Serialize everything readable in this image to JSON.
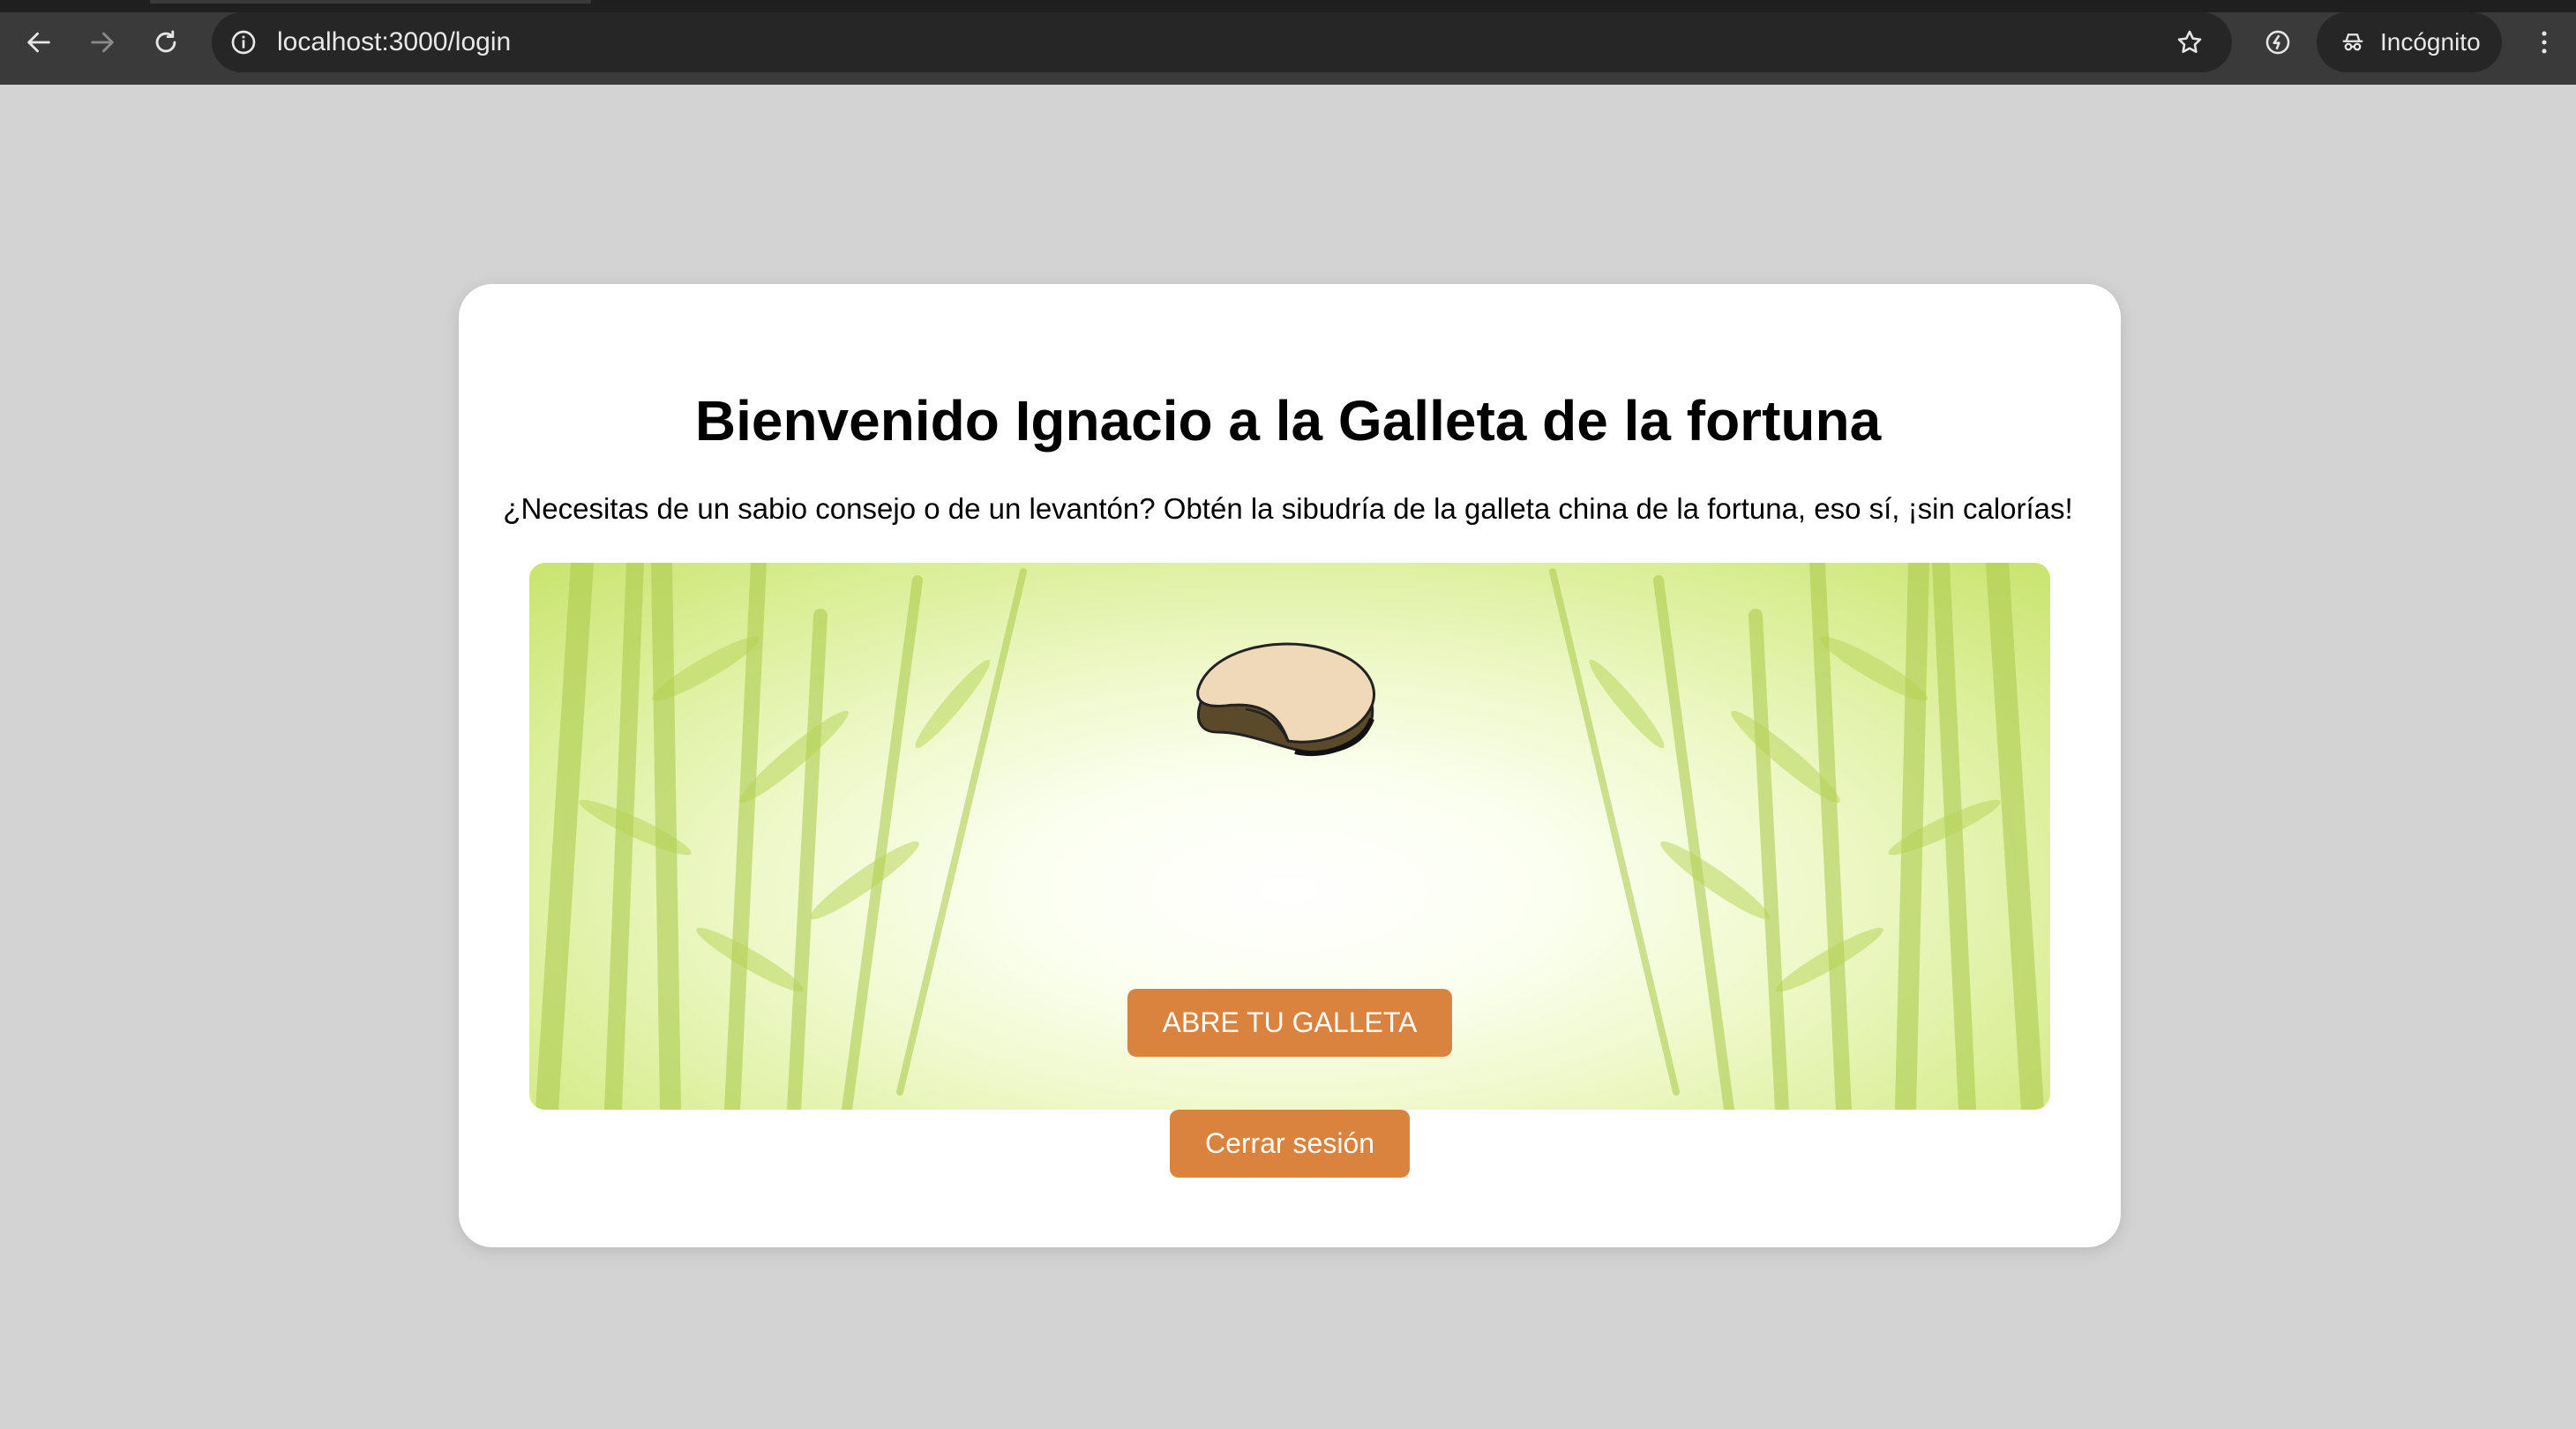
{
  "browser": {
    "url": "localhost:3000/login",
    "incognito_label": "Incógnito",
    "icons": {
      "back": "back-arrow-icon",
      "forward": "forward-arrow-icon",
      "reload": "reload-icon",
      "info": "info-icon",
      "bookmark": "star-icon",
      "extension": "extension-icon",
      "incognito": "incognito-icon",
      "menu": "kebab-menu-icon"
    }
  },
  "page": {
    "title": "Bienvenido Ignacio a la Galleta de la fortuna",
    "subtitle": "¿Necesitas de un sabio consejo o de un levantón? Obtén la sibudría de la galleta china de la fortuna, eso sí, ¡sin calorías!",
    "open_button": "ABRE TU GALLETA",
    "logout_button": "Cerrar sesión"
  },
  "colors": {
    "page_background": "#d3d3d3",
    "card_background": "#ffffff",
    "button_background": "#d9833f",
    "button_text": "#ffffff",
    "bamboo_green": "#c9e46e"
  }
}
